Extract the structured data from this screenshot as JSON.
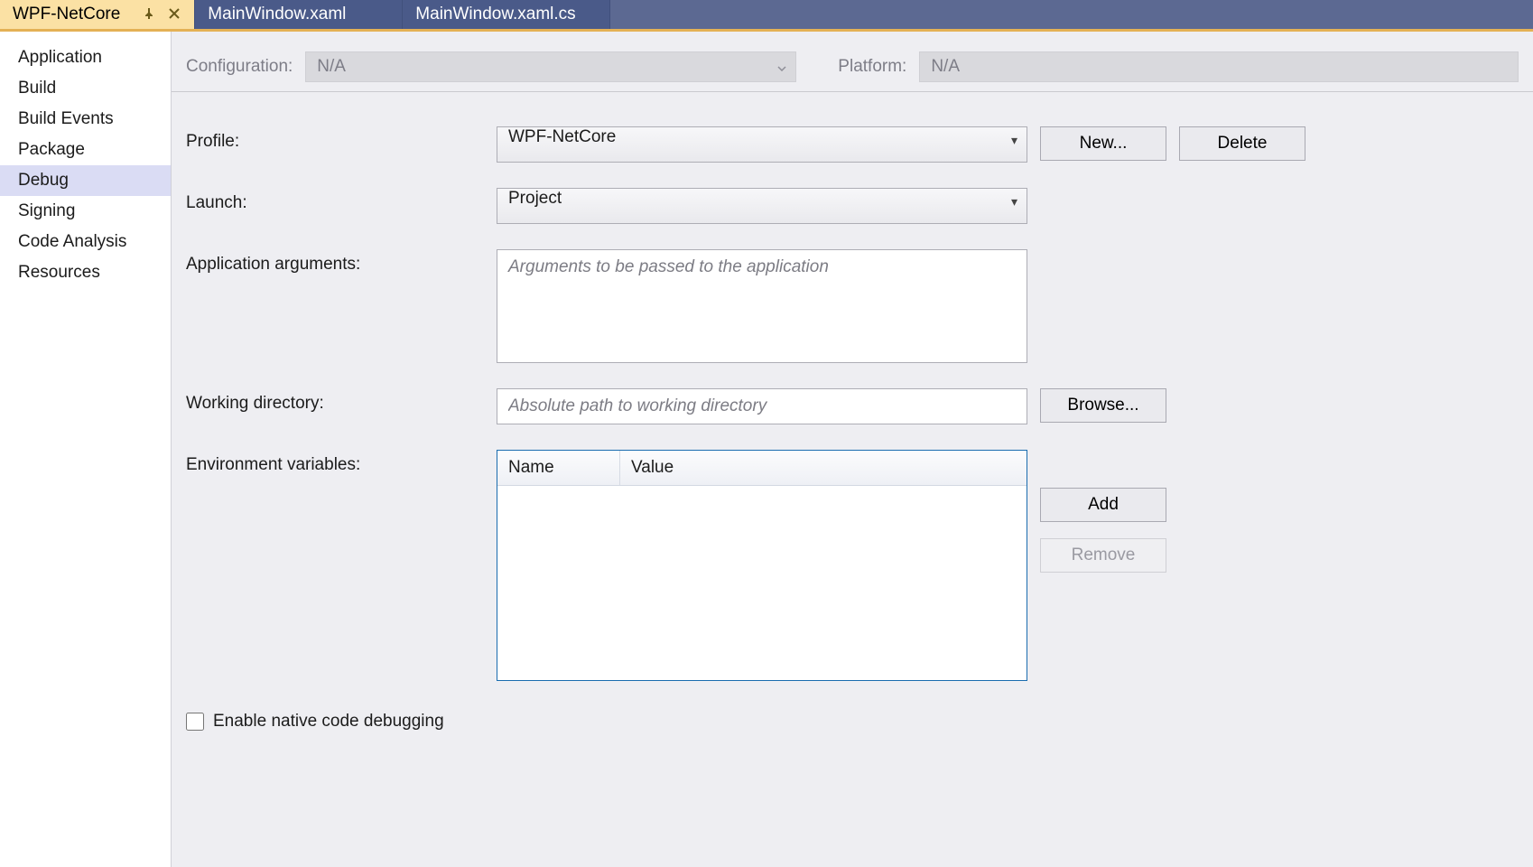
{
  "tabs": {
    "active": "WPF-NetCore",
    "others": [
      "MainWindow.xaml",
      "MainWindow.xaml.cs"
    ]
  },
  "sidebar": {
    "items": [
      {
        "label": "Application",
        "selected": false
      },
      {
        "label": "Build",
        "selected": false
      },
      {
        "label": "Build Events",
        "selected": false
      },
      {
        "label": "Package",
        "selected": false
      },
      {
        "label": "Debug",
        "selected": true
      },
      {
        "label": "Signing",
        "selected": false
      },
      {
        "label": "Code Analysis",
        "selected": false
      },
      {
        "label": "Resources",
        "selected": false
      }
    ]
  },
  "topbar": {
    "configuration_label": "Configuration:",
    "configuration_value": "N/A",
    "platform_label": "Platform:",
    "platform_value": "N/A"
  },
  "labels": {
    "profile": "Profile:",
    "launch": "Launch:",
    "app_args": "Application arguments:",
    "working_dir": "Working directory:",
    "env_vars": "Environment variables:",
    "native_dbg": "Enable native code debugging"
  },
  "values": {
    "profile": "WPF-NetCore",
    "launch": "Project",
    "app_args": "",
    "app_args_placeholder": "Arguments to be passed to the application",
    "working_dir": "",
    "working_dir_placeholder": "Absolute path to working directory",
    "native_dbg_checked": false,
    "env_headers": {
      "name": "Name",
      "value": "Value"
    },
    "env_rows": []
  },
  "buttons": {
    "new": "New...",
    "delete": "Delete",
    "browse": "Browse...",
    "add": "Add",
    "remove": "Remove"
  }
}
